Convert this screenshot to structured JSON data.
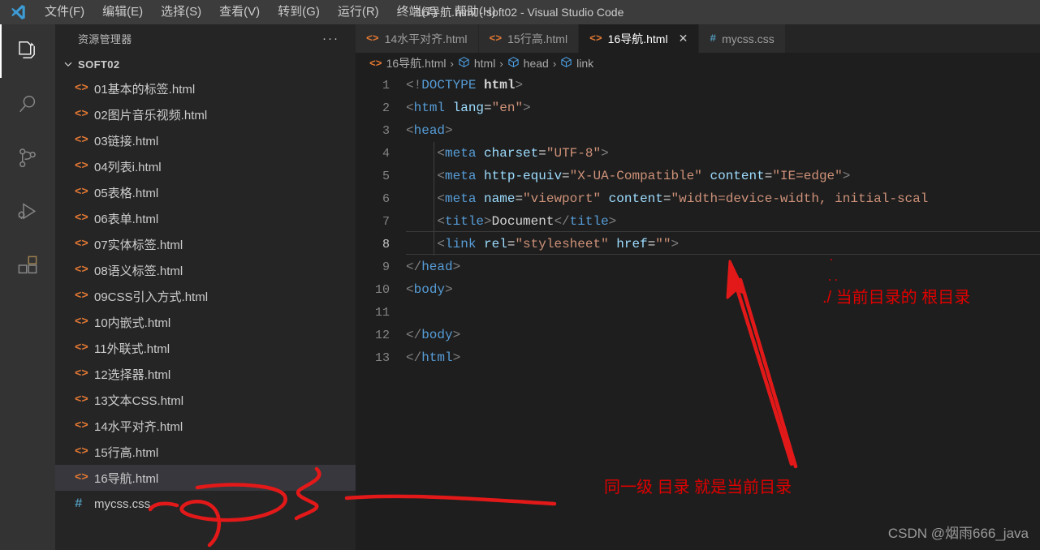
{
  "window": {
    "title": "16导航.html - soft02 - Visual Studio Code",
    "logo_icon": "vscode-logo-icon"
  },
  "menubar": {
    "items": [
      {
        "label": "文件(F)",
        "name": "menu-file"
      },
      {
        "label": "编辑(E)",
        "name": "menu-edit"
      },
      {
        "label": "选择(S)",
        "name": "menu-selection"
      },
      {
        "label": "查看(V)",
        "name": "menu-view"
      },
      {
        "label": "转到(G)",
        "name": "menu-go"
      },
      {
        "label": "运行(R)",
        "name": "menu-run"
      },
      {
        "label": "终端(T)",
        "name": "menu-terminal"
      },
      {
        "label": "帮助(H)",
        "name": "menu-help"
      }
    ]
  },
  "activitybar": {
    "items": [
      {
        "icon": "files-explorer-icon",
        "active": true
      },
      {
        "icon": "search-icon",
        "active": false
      },
      {
        "icon": "source-control-icon",
        "active": false
      },
      {
        "icon": "run-and-debug-icon",
        "active": false
      },
      {
        "icon": "extensions-icon",
        "active": false
      }
    ]
  },
  "sidebar": {
    "title": "资源管理器",
    "more_actions": "···",
    "root_folder": "SOFT02",
    "files": [
      {
        "name": "01基本的标签.html",
        "icon": "html-file-icon",
        "selected": false
      },
      {
        "name": "02图片音乐视频.html",
        "icon": "html-file-icon",
        "selected": false
      },
      {
        "name": "03链接.html",
        "icon": "html-file-icon",
        "selected": false
      },
      {
        "name": "04列表i.html",
        "icon": "html-file-icon",
        "selected": false
      },
      {
        "name": "05表格.html",
        "icon": "html-file-icon",
        "selected": false
      },
      {
        "name": "06表单.html",
        "icon": "html-file-icon",
        "selected": false
      },
      {
        "name": "07实体标签.html",
        "icon": "html-file-icon",
        "selected": false
      },
      {
        "name": "08语义标签.html",
        "icon": "html-file-icon",
        "selected": false
      },
      {
        "name": "09CSS引入方式.html",
        "icon": "html-file-icon",
        "selected": false
      },
      {
        "name": "10内嵌式.html",
        "icon": "html-file-icon",
        "selected": false
      },
      {
        "name": "11外联式.html",
        "icon": "html-file-icon",
        "selected": false
      },
      {
        "name": "12选择器.html",
        "icon": "html-file-icon",
        "selected": false
      },
      {
        "name": "13文本CSS.html",
        "icon": "html-file-icon",
        "selected": false
      },
      {
        "name": "14水平对齐.html",
        "icon": "html-file-icon",
        "selected": false
      },
      {
        "name": "15行高.html",
        "icon": "html-file-icon",
        "selected": false
      },
      {
        "name": "16导航.html",
        "icon": "html-file-icon",
        "selected": true
      },
      {
        "name": "mycss.css",
        "icon": "css-file-icon",
        "selected": false
      }
    ]
  },
  "tabs": [
    {
      "label": "14水平对齐.html",
      "icon": "html-file-icon",
      "active": false,
      "closable": false
    },
    {
      "label": "15行高.html",
      "icon": "html-file-icon",
      "active": false,
      "closable": false
    },
    {
      "label": "16导航.html",
      "icon": "html-file-icon",
      "active": true,
      "closable": true,
      "close_label": "✕"
    },
    {
      "label": "mycss.css",
      "icon": "css-file-icon",
      "active": false,
      "closable": false
    }
  ],
  "breadcrumb": {
    "separator": "›",
    "items": [
      {
        "label": "16导航.html",
        "icon": "html-file-icon"
      },
      {
        "label": "html",
        "icon": "symbol-cube-icon"
      },
      {
        "label": "head",
        "icon": "symbol-cube-icon"
      },
      {
        "label": "link",
        "icon": "symbol-cube-icon"
      }
    ]
  },
  "code": {
    "lines": [
      {
        "number": "1",
        "text": "<!DOCTYPE html>"
      },
      {
        "number": "2",
        "text": "<html lang=\"en\">"
      },
      {
        "number": "3",
        "text": "<head>"
      },
      {
        "number": "4",
        "text": "    <meta charset=\"UTF-8\">"
      },
      {
        "number": "5",
        "text": "    <meta http-equiv=\"X-UA-Compatible\" content=\"IE=edge\">"
      },
      {
        "number": "6",
        "text": "    <meta name=\"viewport\" content=\"width=device-width, initial-scal"
      },
      {
        "number": "7",
        "text": "    <title>Document</title>"
      },
      {
        "number": "8",
        "text": "    <link rel=\"stylesheet\" href=\"\">"
      },
      {
        "number": "9",
        "text": "</head>"
      },
      {
        "number": "10",
        "text": "<body>"
      },
      {
        "number": "11",
        "text": ""
      },
      {
        "number": "12",
        "text": "</body>"
      },
      {
        "number": "13",
        "text": "</html>"
      }
    ]
  },
  "annotations": {
    "dot_single": ".",
    "dot_double": "..",
    "root_note": "./ 当前目录的 根目录",
    "same_level_note": "同一级 目录   就是当前目录"
  },
  "watermark": {
    "text": "CSDN @烟雨666_java"
  },
  "colors": {
    "titlebar": "#3c3c3c",
    "activitybar": "#333333",
    "sidebar": "#252526",
    "editor": "#1e1e1e",
    "selected_row": "#37373d",
    "annotation_red": "#e00000",
    "html_icon": "#e37933",
    "css_icon": "#519aba",
    "tag_blue": "#569cd6",
    "attr_blue": "#9cdcfe",
    "string_orange": "#ce9178"
  }
}
